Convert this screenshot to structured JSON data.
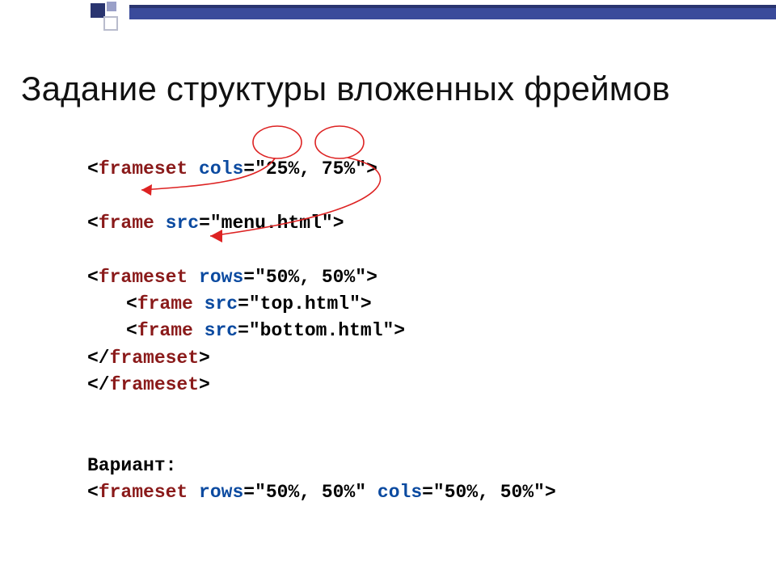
{
  "title": "Задание структуры вложенных фреймов",
  "code": {
    "l1": {
      "open": "<",
      "tag": "frameset",
      "sp": " ",
      "a1": "cols",
      "eq": "=\"25%, 75%\">"
    },
    "l2": "",
    "l3": {
      "open": "<",
      "tag": "frame",
      "sp": " ",
      "a1": "src",
      "eq": "=\"menu.html\">"
    },
    "l4": "",
    "l5": {
      "open": "<",
      "tag": "frameset",
      "sp": " ",
      "a1": "rows",
      "eq": "=\"50%, 50%\">"
    },
    "l6": {
      "open": "<",
      "tag": "frame",
      "sp": " ",
      "a1": "src",
      "eq": "=\"top.html\">"
    },
    "l7": {
      "open": "<",
      "tag": "frame",
      "sp": " ",
      "a1": "src",
      "eq": "=\"bottom.html\">"
    },
    "l8": {
      "open": "</",
      "tag": "frameset",
      "close": ">"
    },
    "l9": {
      "open": "</",
      "tag": "frameset",
      "close": ">"
    },
    "variant_label": "Вариант:",
    "v1": {
      "open": "<",
      "tag": "frameset",
      "sp": " ",
      "a1": "rows",
      "mid": "=\"50%, 50%\" ",
      "a2": "cols",
      "end": "=\"50%, 50%\">"
    }
  }
}
